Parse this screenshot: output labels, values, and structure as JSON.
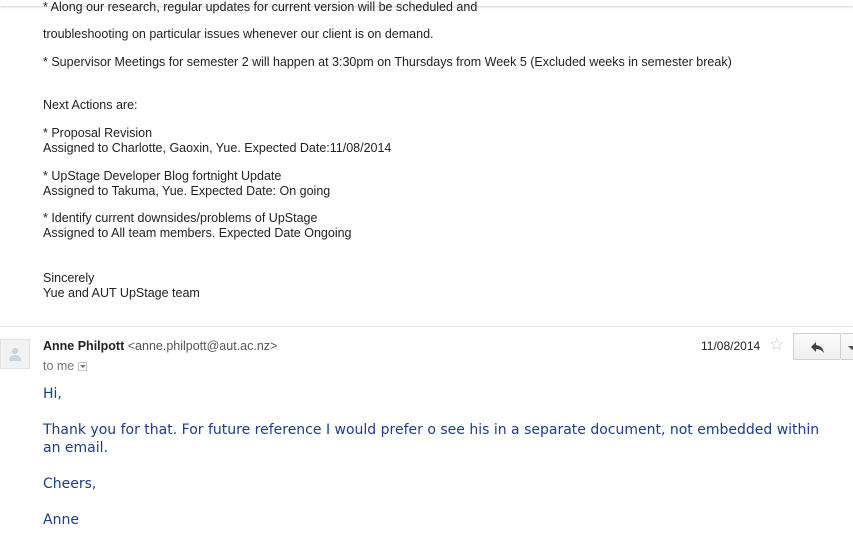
{
  "previous_message": {
    "lines": [
      "* Along our research, regular updates for current version will be scheduled and",
      "troubleshooting on particular issues whenever our client is on demand.",
      "* Supervisor Meetings for semester 2 will happen at 3:30pm on Thursdays from Week 5 (Excluded weeks in semester break)",
      "Next Actions are:",
      "* Proposal Revision",
      "Assigned to Charlotte, Gaoxin, Yue.  Expected Date:11/08/2014",
      "* UpStage Developer Blog fortnight Update",
      "Assigned to Takuma, Yue. Expected Date: On going",
      "* Identify current downsides/problems of UpStage",
      "Assigned to All team members. Expected Date Ongoing",
      "Sincerely",
      "Yue and AUT UpStage team"
    ]
  },
  "message": {
    "sender_name": "Anne Philpott",
    "sender_email": "<anne.philpott@aut.ac.nz>",
    "recipient": "to me",
    "date": "11/08/2014",
    "body": {
      "greeting": "Hi,",
      "paragraph": "Thank you for that. For future reference I would prefer o see his in a separate document, not embedded within an email.",
      "closing": "Cheers,",
      "signature": "Anne"
    }
  },
  "icons": {
    "avatar": "person-icon",
    "star": "star-icon",
    "reply": "reply-icon",
    "more": "chevron-down-icon"
  },
  "colors": {
    "body_text": "#1a3c8c",
    "meta_text": "#777777"
  }
}
